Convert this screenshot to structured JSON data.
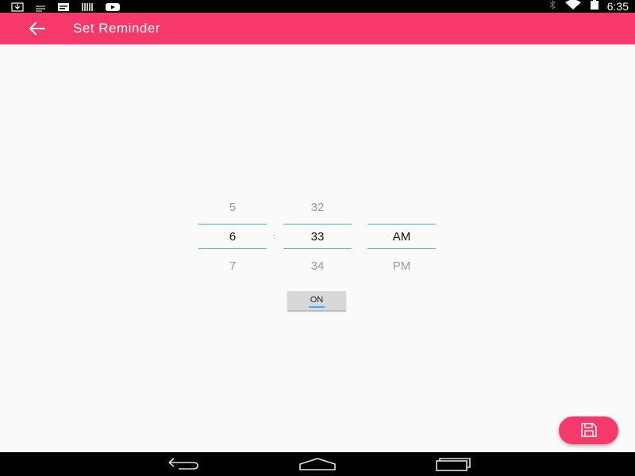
{
  "status_bar": {
    "time": "6:35",
    "left_icons": [
      "download-icon",
      "message-icon",
      "barcode-icon",
      "video-icon"
    ],
    "right_icons": [
      "bluetooth-icon",
      "wifi-icon",
      "battery-icon"
    ]
  },
  "app_bar": {
    "title": "Set Reminder",
    "back_icon": "arrow-back-icon",
    "color": "#f7386b"
  },
  "time_picker": {
    "hour": {
      "prev": "5",
      "current": "6",
      "next": "7"
    },
    "separator": ":",
    "minute": {
      "prev": "32",
      "current": "33",
      "next": "34"
    },
    "period": {
      "prev": "",
      "current": "AM",
      "next": "PM"
    },
    "divider_color": "#4fb0de"
  },
  "toggle": {
    "label": "ON",
    "indicator_color": "#33b5e5"
  },
  "fab": {
    "icon": "save-icon",
    "color": "#f7386b"
  },
  "nav_bar": {
    "icons": [
      "back-nav-icon",
      "home-nav-icon",
      "recents-nav-icon"
    ]
  }
}
